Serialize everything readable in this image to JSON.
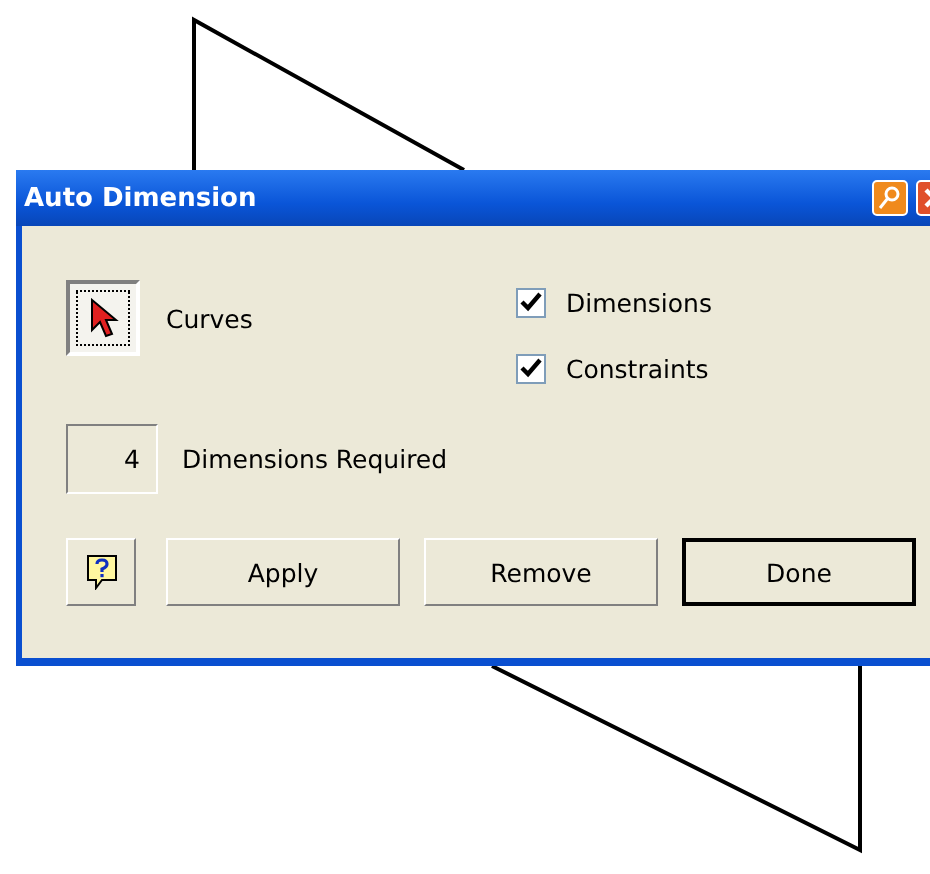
{
  "window": {
    "title": "Auto Dimension"
  },
  "select": {
    "label": "Curves",
    "selected": true
  },
  "options": [
    {
      "label": "Dimensions",
      "checked": true
    },
    {
      "label": "Constraints",
      "checked": true
    }
  ],
  "count": {
    "value": "4",
    "label": "Dimensions Required"
  },
  "buttons": [
    {
      "label": "Apply",
      "default": false
    },
    {
      "label": "Remove",
      "default": false
    },
    {
      "label": "Done",
      "default": true
    }
  ]
}
